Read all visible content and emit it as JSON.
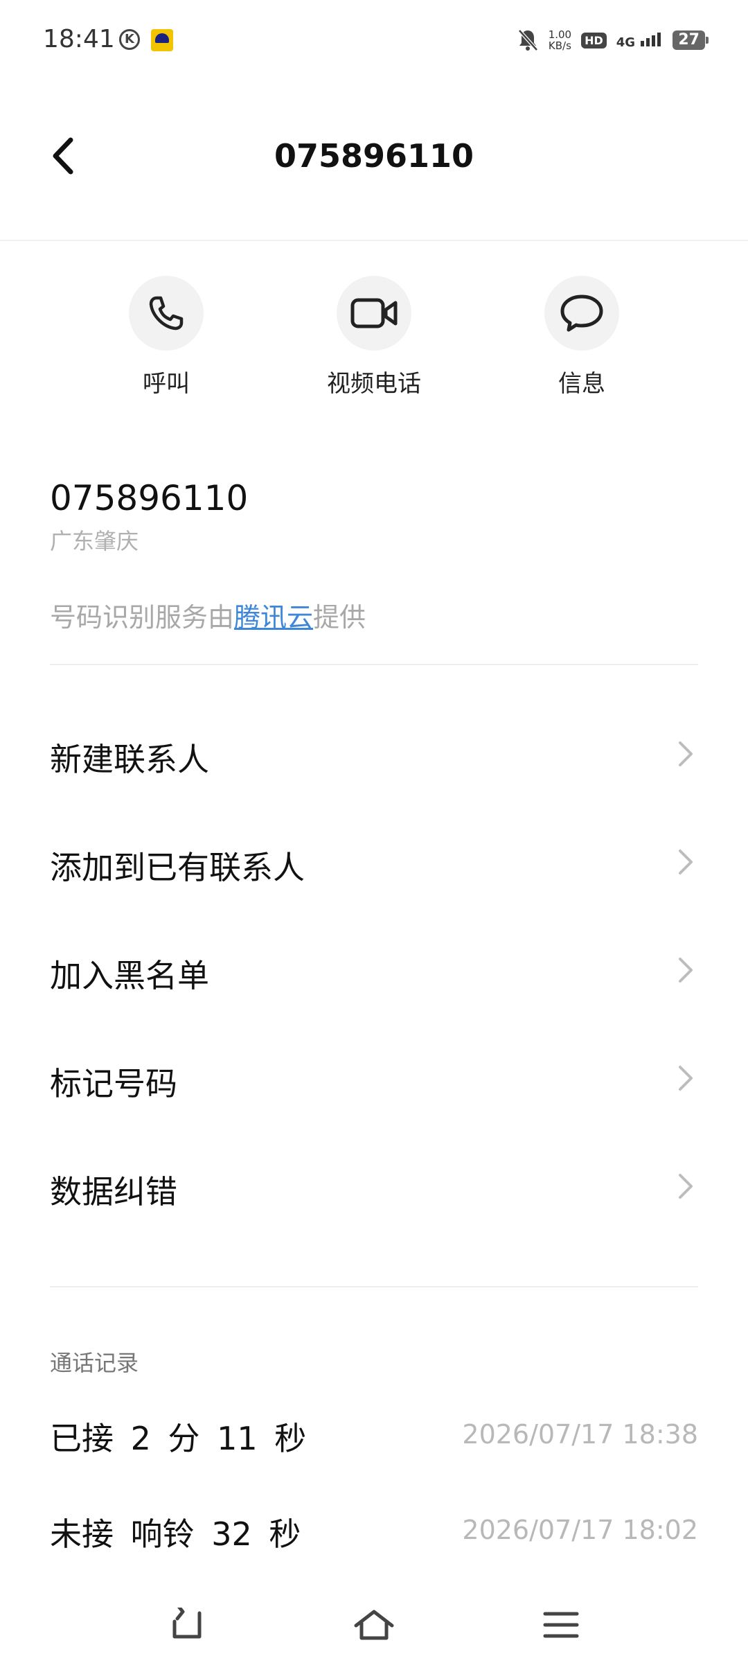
{
  "status": {
    "time": "18:41",
    "k_icon": "K",
    "speed_top": "1.00",
    "speed_bottom": "KB/s",
    "hd": "HD",
    "network": "4G",
    "battery": "27"
  },
  "header": {
    "title": "075896110"
  },
  "actions": [
    {
      "label": "呼叫",
      "icon": "phone-icon"
    },
    {
      "label": "视频电话",
      "icon": "video-icon"
    },
    {
      "label": "信息",
      "icon": "message-icon"
    }
  ],
  "contact": {
    "number": "075896110",
    "location": "广东肇庆",
    "provider_prefix": "号码识别服务由",
    "provider_link": "腾讯云",
    "provider_suffix": "提供"
  },
  "menu": [
    {
      "label": "新建联系人"
    },
    {
      "label": "添加到已有联系人"
    },
    {
      "label": "加入黑名单"
    },
    {
      "label": "标记号码"
    },
    {
      "label": "数据纠错"
    }
  ],
  "call_log": {
    "title": "通话记录",
    "entries": [
      {
        "type": "已接 2 分 11 秒",
        "time": "2026/07/17 18:38"
      },
      {
        "type": "未接 响铃 32 秒",
        "time": "2026/07/17 18:02"
      }
    ]
  },
  "colors": {
    "link": "#3d86d8",
    "circle_bg": "#f2f2f2"
  }
}
